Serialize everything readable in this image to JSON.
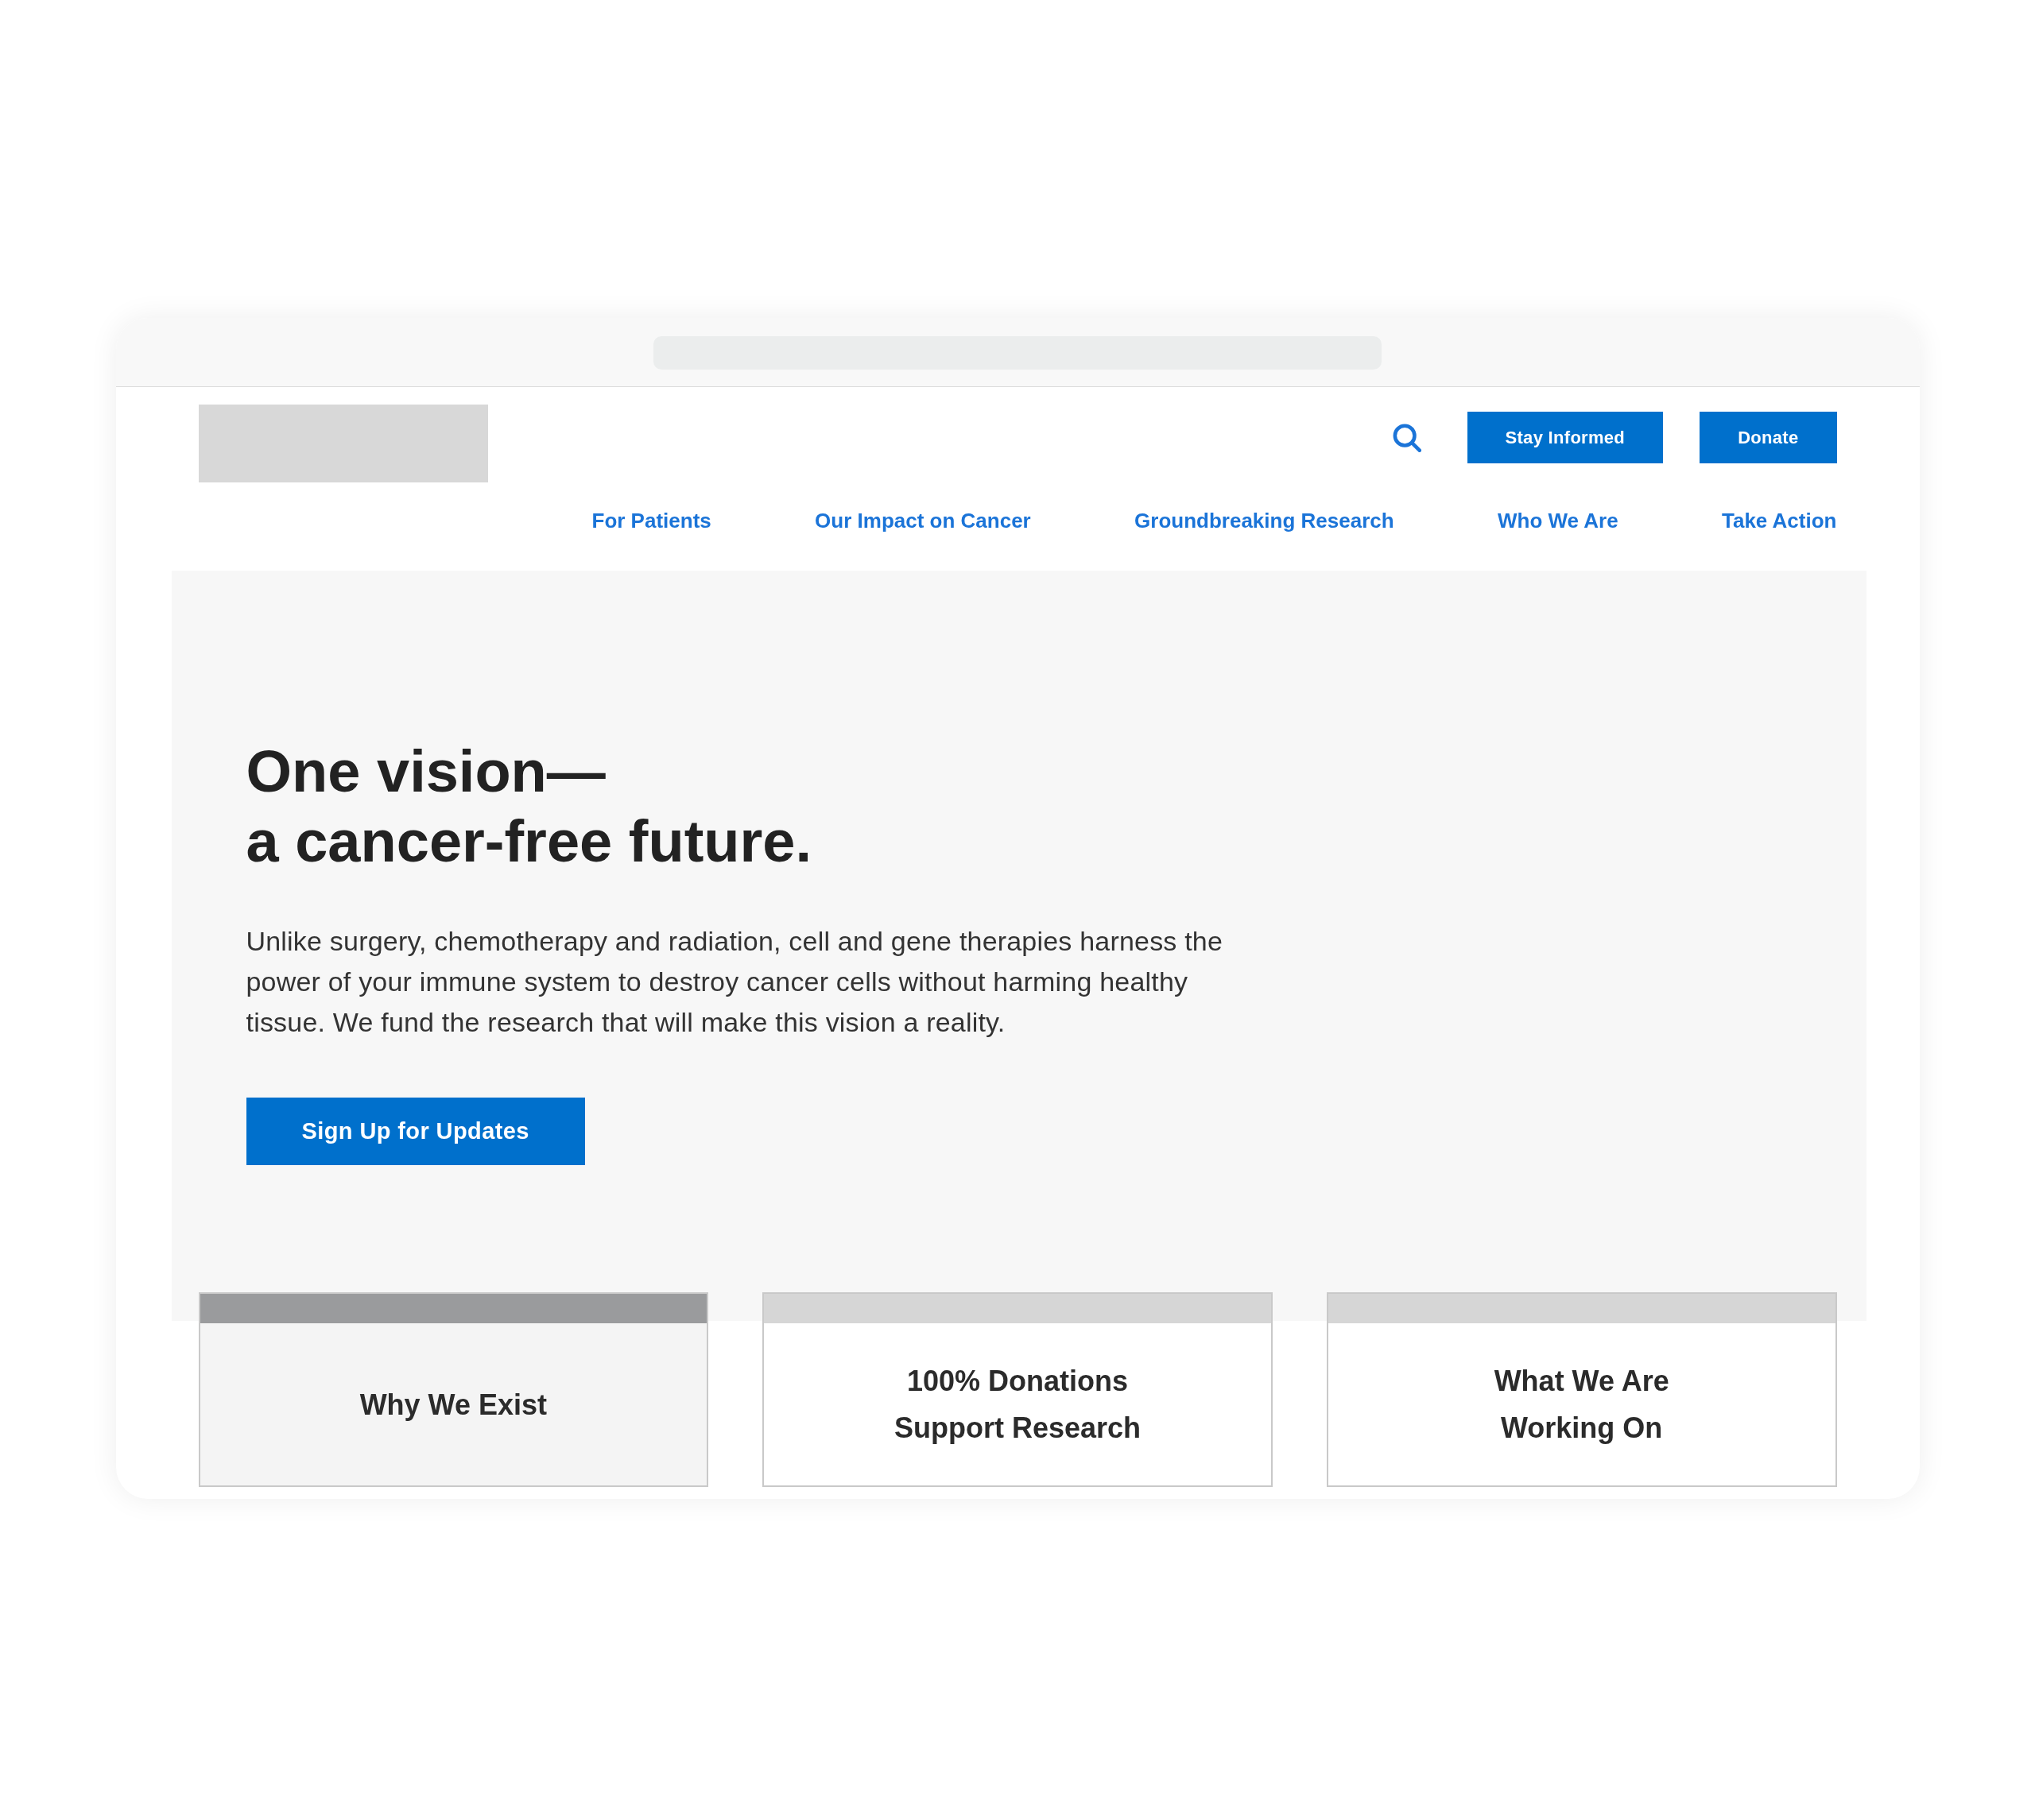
{
  "header": {
    "buttons": [
      "Stay Informed",
      "Donate"
    ],
    "nav": [
      "For Patients",
      "Our Impact on Cancer",
      "Groundbreaking Research",
      "Who We Are",
      "Take Action"
    ]
  },
  "hero": {
    "title_lines": [
      "One vision—",
      "a cancer-free future."
    ],
    "text": "Unlike surgery, chemotherapy and radiation, cell and gene therapies harness the power of your immune system to destroy cancer cells without harming healthy tissue. We fund the research that will make this vision a reality.",
    "button": "Sign Up for Updates"
  },
  "cards": [
    {
      "title": "Why We Exist",
      "selected": true
    },
    {
      "title": "100% Donations Support Research",
      "selected": false
    },
    {
      "title": "What We Are Working On",
      "selected": false
    }
  ]
}
